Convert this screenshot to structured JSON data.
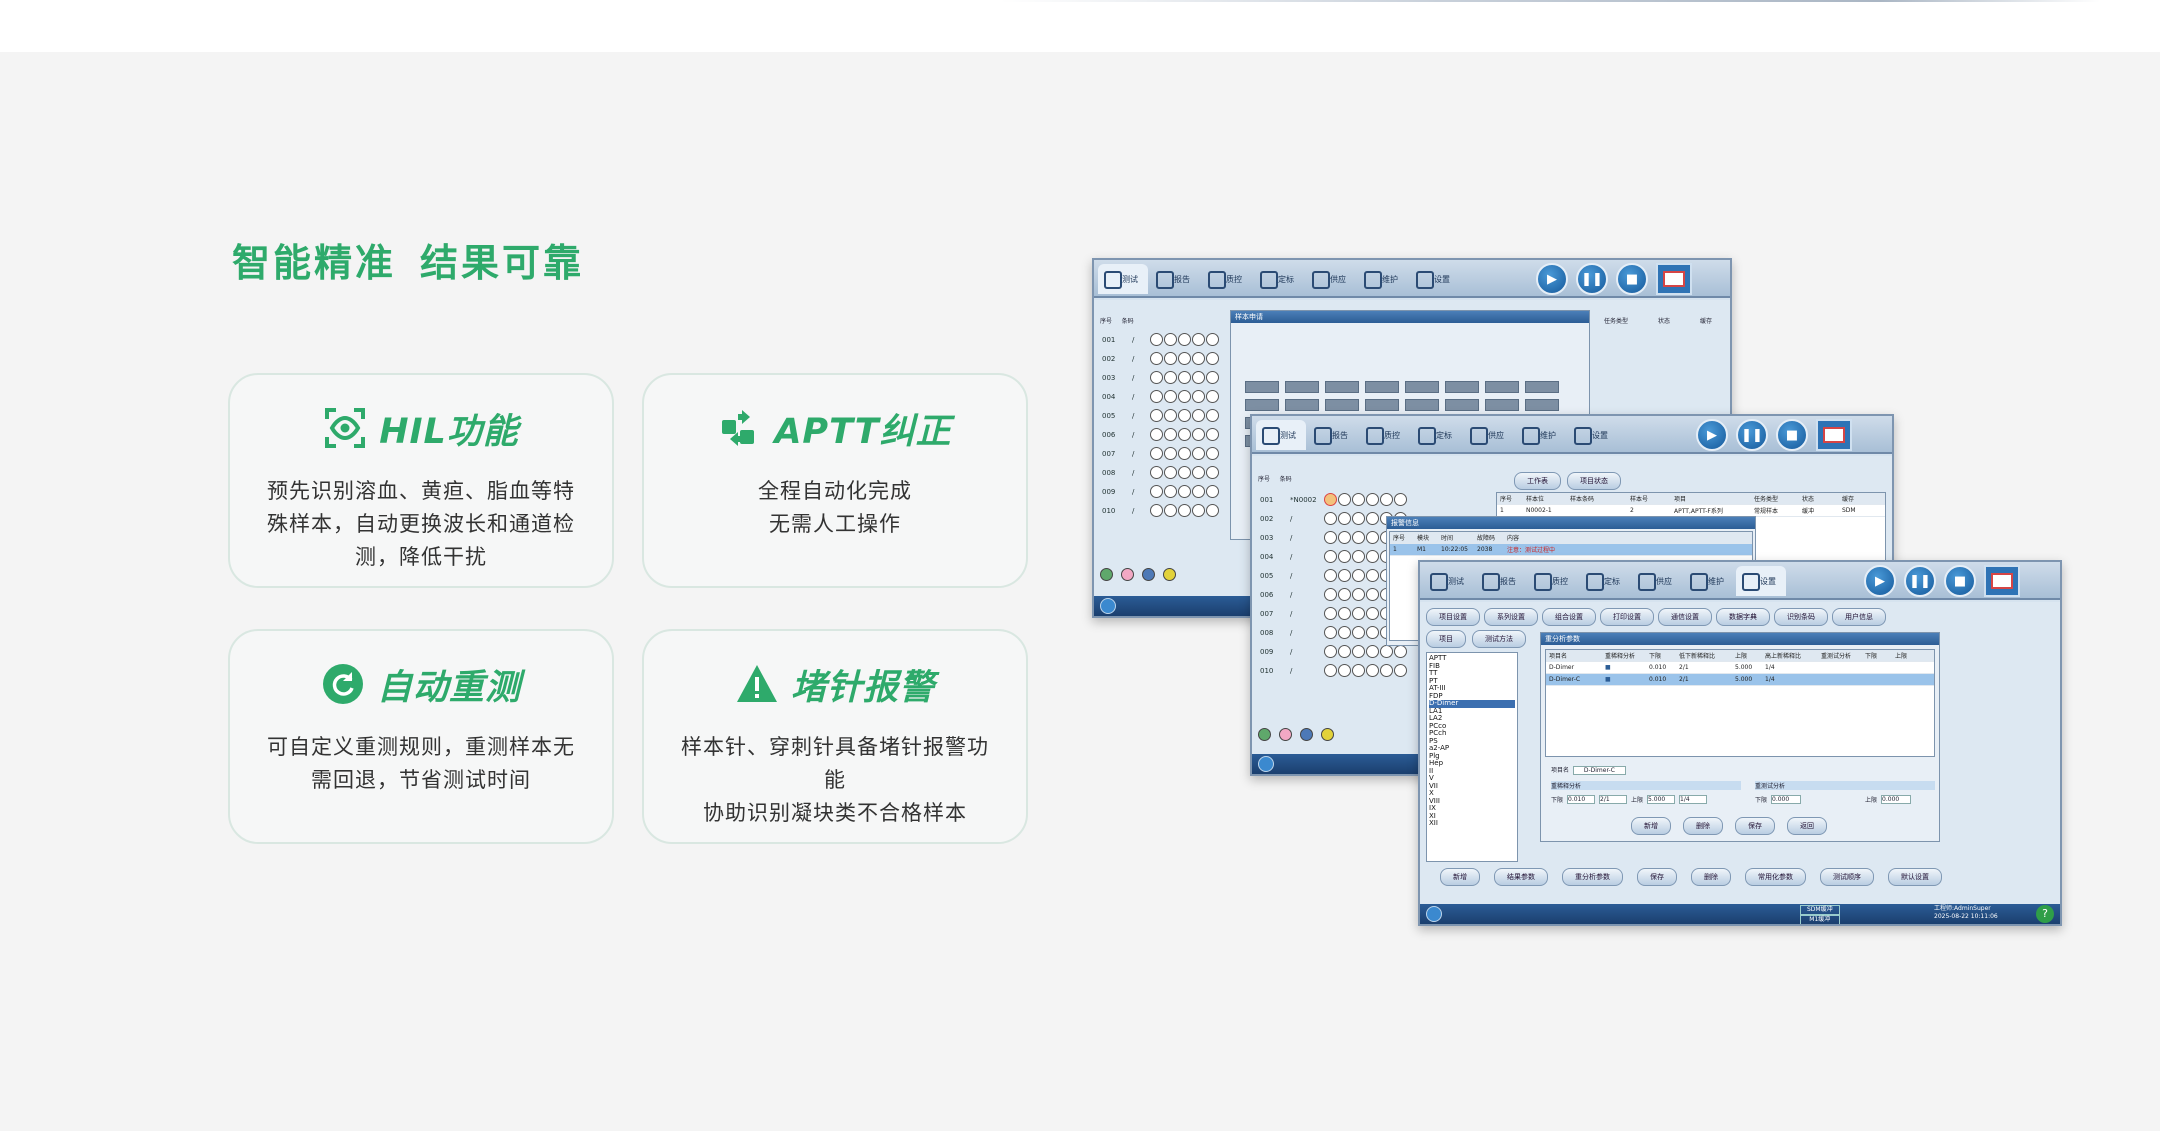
{
  "headline": {
    "part1": "智能精准",
    "part2": "结果可靠"
  },
  "features": [
    {
      "title": "HIL功能",
      "icon": "eye-scan-icon",
      "lines": [
        "预先识别溶血、黄疸、脂血等特",
        "殊样本，自动更换波长和通道检",
        "测，降低干扰"
      ]
    },
    {
      "title": "APTT纠正",
      "icon": "swap-arrows-icon",
      "lines": [
        "全程自动化完成",
        "无需人工操作"
      ]
    },
    {
      "title": "自动重测",
      "icon": "refresh-icon",
      "lines": [
        "可自定义重测规则，重测样本无",
        "需回退，节省测试时间"
      ]
    },
    {
      "title": "堵针报警",
      "icon": "warning-icon",
      "lines": [
        "样本针、穿刺针具备堵针报警功能",
        "协助识别凝块类不合格样本"
      ]
    }
  ],
  "ui": {
    "tabs_a": [
      "测试",
      "报告",
      "质控",
      "定标",
      "供应",
      "维护",
      "设置"
    ],
    "tabs_b": [
      "测试",
      "报告",
      "质控",
      "定标",
      "供应",
      "维护",
      "设置"
    ],
    "tabs_c": [
      "测试",
      "报告",
      "质控",
      "定标",
      "供应",
      "维护",
      "设置"
    ],
    "win_a": {
      "col_seq": "序号",
      "col_code": "条码",
      "rows": [
        "001",
        "002",
        "003",
        "004",
        "005",
        "006",
        "007",
        "008",
        "009",
        "010"
      ],
      "dialog_title": "样本申请",
      "side_headers": [
        "任务类型",
        "状态",
        "缓存"
      ]
    },
    "win_b": {
      "col_seq": "序号",
      "col_code": "条码",
      "rows": [
        "001",
        "002",
        "003",
        "004",
        "005",
        "006",
        "007",
        "008",
        "009",
        "010"
      ],
      "first_code": "*N0002",
      "tabs": [
        "工作表",
        "项目状态"
      ],
      "headers": [
        "序号",
        "样本位",
        "样本条码",
        "样本号",
        "项目",
        "任务类型",
        "状态",
        "缓存"
      ],
      "row1": [
        "1",
        "N0002-1",
        "",
        "2",
        "APTT,APTT-F系列",
        "常规样本",
        "缓冲",
        "SDM"
      ],
      "popup_title": "报警信息",
      "popup_cols": [
        "序号",
        "模块",
        "时间",
        "故障码",
        "内容"
      ],
      "popup_row": [
        "1",
        "M1",
        "10:22:05",
        "2038",
        "注意：测试过程中"
      ]
    },
    "win_c": {
      "subtabs": [
        "项目设置",
        "系列设置",
        "组合设置",
        "打印设置",
        "通信设置",
        "数据字典",
        "识别条码",
        "用户信息"
      ],
      "subtabs2": [
        "项目",
        "测试方法"
      ],
      "panel_title": "重分析参数",
      "items": [
        "APTT",
        "FIB",
        "TT",
        "PT",
        "AT-III",
        "FDP",
        "D-Dimer",
        "LA1",
        "LA2",
        "PCco",
        "PCch",
        "PS",
        "a2-AP",
        "Plg",
        "Hep",
        "II",
        "V",
        "VII",
        "X",
        "VIII",
        "IX",
        "XI",
        "XII"
      ],
      "selected_item": "D-Dimer",
      "table_head": [
        "项目名",
        "重稀释分析",
        "下限",
        "低下新稀释比",
        "上限",
        "高上新稀释比",
        "重测试分析",
        "下限",
        "上限"
      ],
      "table_rows": [
        [
          "D-Dimer",
          "■",
          "0.010",
          "2/1",
          "5.000",
          "1/4"
        ],
        [
          "D-Dimer-C",
          "■",
          "0.010",
          "2/1",
          "5.000",
          "1/4"
        ]
      ],
      "form_name_label": "项目名",
      "form_name_value": "D-Dimer-C",
      "form_section1": "重稀释分析",
      "form_section2": "重测试分析",
      "lower_label": "下限",
      "upper_label": "上限",
      "lower_val": "0.010",
      "ratio_low": "2/1",
      "upper_val": "5.000",
      "ratio_high": "1/4",
      "lower2_val": "0.000",
      "upper2_val": "0.000",
      "panel_buttons": [
        "新增",
        "删除",
        "保存",
        "返回"
      ],
      "bottom_buttons": [
        "新增",
        "结果参数",
        "重分析参数",
        "保存",
        "删除",
        "常用化参数",
        "测试顺序",
        "默认设置"
      ],
      "status_left1": "SDM缓冲",
      "status_left2": "M1缓冲",
      "status_user": "工程师:AdminSuper",
      "status_time": "2025-08-22 10:11:06"
    }
  },
  "colors": {
    "accent": "#2eaa6b",
    "ui_blue": "#1b3f6e"
  }
}
